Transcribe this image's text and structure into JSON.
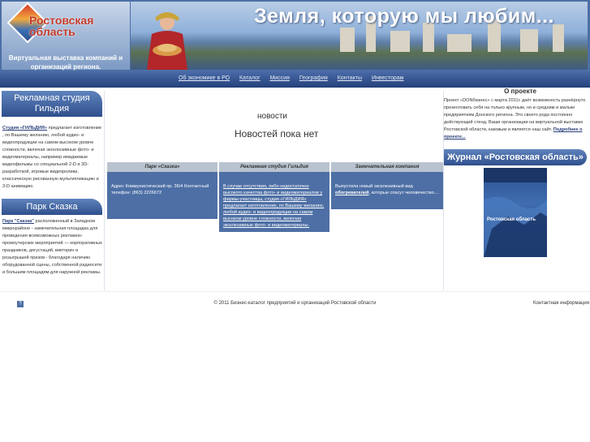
{
  "header": {
    "logo_text": "Ростовская область",
    "logo_subtitle": "Виртуальная выставка компаний и организаций региона.",
    "banner_title": "Земля, которую мы любим..."
  },
  "nav": {
    "items": [
      {
        "label": "Об экономике в РО"
      },
      {
        "label": "Каталог"
      },
      {
        "label": "Миссия"
      },
      {
        "label": "География"
      },
      {
        "label": "Контакты"
      },
      {
        "label": "Инвесторам"
      }
    ]
  },
  "left": {
    "studio": {
      "title": "Рекламная студия Гильдия",
      "link": "Студия «ГИЛЬДИЯ»",
      "text": "предлагает изготовление , по Вашему желанию, любой аудио- и видеопродукции на самом высоком уровне сложности, включая эксклюзивные фото- и видеоматериалы, например имиджевые видеофильмы со специальной 2-D и 3D-разработкой, игровые видеоролики, классическую рисованную мультипликацию и 3-D анимацию."
    },
    "park": {
      "title": "Парк Сказка",
      "link": "Парк \"Сказка\"",
      "text": "расположенный в Западном микрорайоне - замечательная площадка для проведения всевозможных рекламно-промоутерских мероприятий — корпоративных праздников, дегустаций, викторин и розыгрышей призов - благодаря наличию оборудованной сцены, собственной радиосети и большим площадям для наружной рекламы."
    }
  },
  "center": {
    "news_title": "новости",
    "news_empty": "Новостей пока нет",
    "columns": [
      {
        "head": "Парк «Сказка»",
        "body": "Адрес Коммунистический пр. 36/4 Контактный телефон: (863) 2226672"
      },
      {
        "head": "Рекламная студия Гильдия",
        "body": "В случае отсутствия, либо недостаточно высокого качества фото- и видеоматериалов у фирмы-участницы, студия «ГИЛЬДИЯ» предлагает изготовление, по Вашему желанию, любой аудио- и видеопродукции на самом высоком уровне сложности, включая эксклюзивные фото- и видеоматериалы."
      },
      {
        "head": "Замечательная компания",
        "body_pre": "Выпустила новый эксклюзивный вид",
        "body_link": "обогревателей",
        "body_post": ", которые спасут человечество...."
      }
    ]
  },
  "right": {
    "about_title": "О проекте",
    "about_text": "Проект «DONбизнес» с марта 2011г. даёт возможность разнёрнуто презентовать себя на только крупным, но и средним и малым предприятиям Донского региона. Это своего рода постоянно действующий стенд. Ваши организации на виртуальной выставке Ростовской области, каковым и является наш сайт.",
    "about_link": "Подробнее о проекте...",
    "journal_title": "Журнал «Ростовская область»",
    "magazine_label": "Ростовская область"
  },
  "footer": {
    "help": "?",
    "copyright": "© 2011 Бизнес-каталог предприятий и организаций Ростовской области",
    "contacts": "Контактная информация"
  },
  "colors": {
    "primary": "#4d6fa5",
    "nav_dark": "#23407a",
    "header_gray": "#b9c3cf"
  }
}
